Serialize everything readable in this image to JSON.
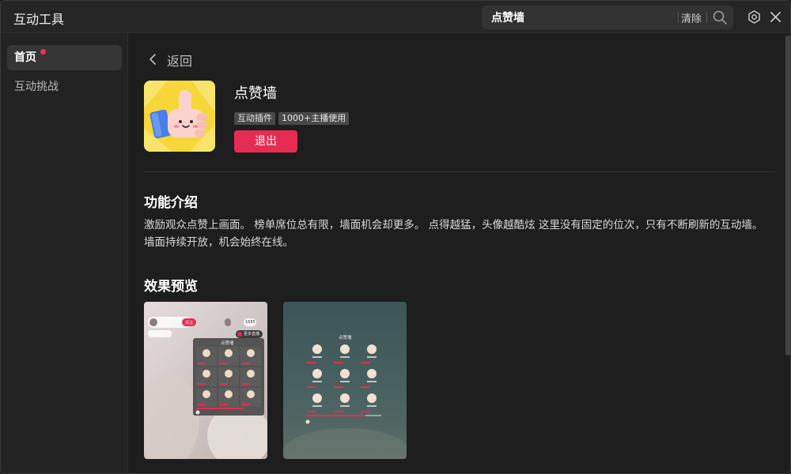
{
  "window": {
    "title": "互动工具"
  },
  "search": {
    "value": "点赞墙",
    "clear_label": "清除"
  },
  "sidebar": {
    "items": [
      {
        "label": "首页",
        "active": true,
        "badge": true
      },
      {
        "label": "互动挑战",
        "active": false,
        "badge": false
      }
    ]
  },
  "main": {
    "back_label": "返回",
    "plugin": {
      "name": "点赞墙",
      "tags": [
        "互动插件",
        "1000+主播使用"
      ],
      "exit_label": "退出"
    },
    "intro": {
      "title": "功能介绍",
      "text": "激励观众点赞上画面。 榜单席位总有限，墙面机会却更多。 点得越猛，头像越酷炫 这里没有固定的位次，只有不断刷新的互动墙。 墙面持续开放，机会始终在线。"
    },
    "preview": {
      "title": "效果预览",
      "card1": {
        "follow_label": "关注",
        "viewer_count": "1685",
        "wall_title": "点赞墙",
        "more_label": "更多直播"
      },
      "card2": {
        "wall_title": "点赞墙"
      }
    }
  },
  "colors": {
    "accent": "#e72c53",
    "badge": "#f0304e",
    "background": "#1e1e1e",
    "sidebar_bg": "#232323",
    "icon_bg": "#f7d63a"
  }
}
